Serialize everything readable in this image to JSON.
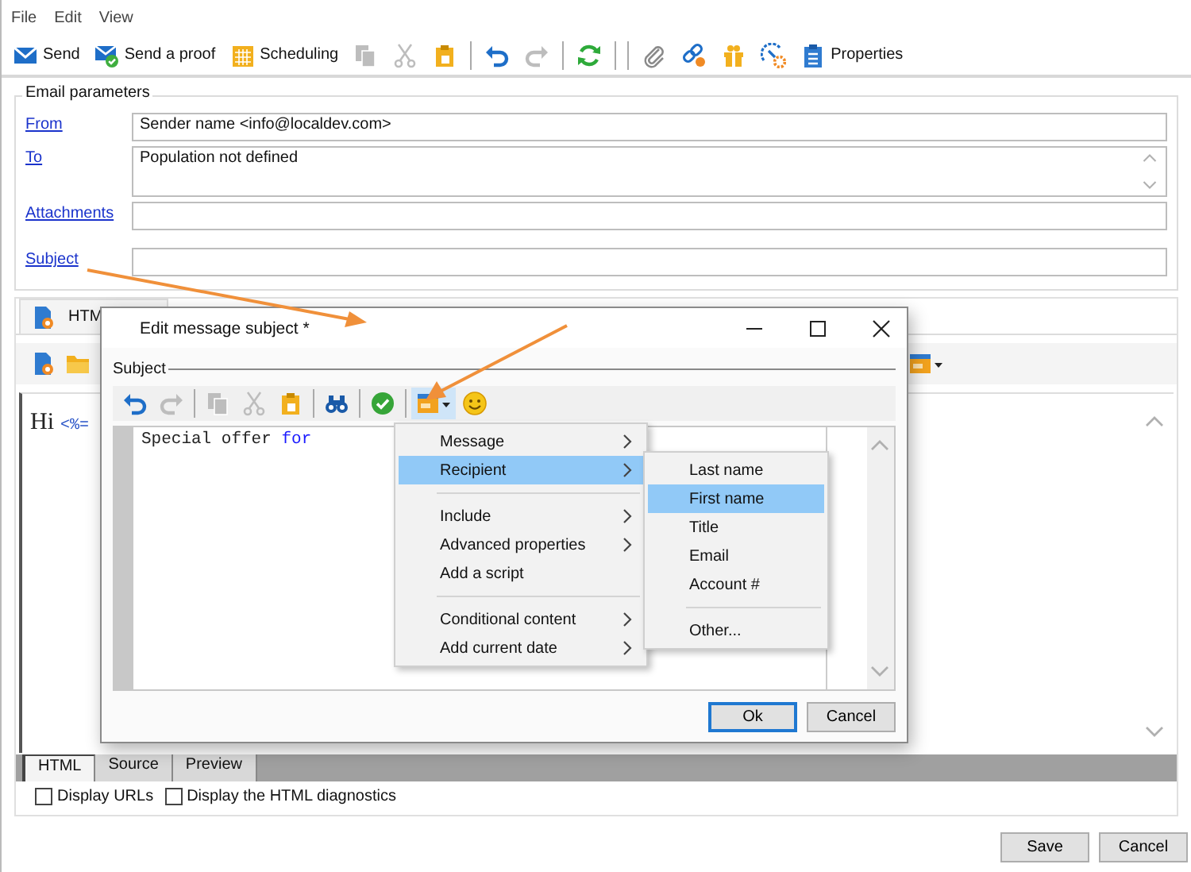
{
  "menu_bar": [
    {
      "label": "File"
    },
    {
      "label": "Edit"
    },
    {
      "label": "View"
    }
  ],
  "toolbar": [
    {
      "kind": "button",
      "label": "Send",
      "disabled": false
    },
    {
      "kind": "button",
      "label": "Send a proof",
      "disabled": false
    },
    {
      "kind": "button",
      "label": "Scheduling",
      "disabled": false
    },
    {
      "kind": "button",
      "disabled": true
    },
    {
      "kind": "button",
      "disabled": true
    },
    {
      "kind": "button",
      "disabled": false
    },
    {
      "kind": "separator"
    },
    {
      "kind": "button",
      "disabled": false
    },
    {
      "kind": "button",
      "disabled": true
    },
    {
      "kind": "separator"
    },
    {
      "kind": "button",
      "disabled": false
    },
    {
      "kind": "separator"
    },
    {
      "kind": "separator"
    },
    {
      "kind": "button",
      "disabled": false
    },
    {
      "kind": "button",
      "disabled": false
    },
    {
      "kind": "button",
      "disabled": false
    },
    {
      "kind": "button",
      "disabled": false
    },
    {
      "kind": "button",
      "label": "Properties",
      "disabled": false
    }
  ],
  "email_parameters": {
    "title": "Email parameters",
    "fields": [
      {
        "label": "From",
        "kind": "line",
        "value": "Sender name <info@localdev.com>"
      },
      {
        "label": "To",
        "kind": "multiline",
        "value": "Population not defined"
      },
      {
        "label": "Attachments",
        "kind": "line"
      },
      {
        "label": "Subject",
        "kind": "line"
      }
    ]
  },
  "content_tabs": [
    {
      "label": "HTM"
    }
  ],
  "editor_lines": [
    [
      {
        "kind": "plain",
        "text": "Hi"
      },
      {
        "kind": "code",
        "text": "<%="
      }
    ]
  ],
  "view_tabs": [
    {
      "label": "HTML",
      "selected": true
    },
    {
      "label": "Source",
      "selected": false
    },
    {
      "label": "Preview",
      "selected": false
    }
  ],
  "options": [
    {
      "label": "Display URLs",
      "checked": false
    },
    {
      "label": "Display the HTML diagnostics",
      "checked": false
    }
  ],
  "buttons": [
    {
      "label": "Save"
    },
    {
      "label": "Cancel"
    }
  ],
  "dialog": {
    "title": "Edit message subject *",
    "section": "Subject",
    "toolbar": [
      {
        "kind": "button",
        "disabled": false
      },
      {
        "kind": "button",
        "disabled": true
      },
      {
        "kind": "separator"
      },
      {
        "kind": "button",
        "disabled": true
      },
      {
        "kind": "button",
        "disabled": true
      },
      {
        "kind": "button",
        "disabled": false
      },
      {
        "kind": "separator"
      },
      {
        "kind": "button",
        "disabled": false
      },
      {
        "kind": "separator"
      },
      {
        "kind": "button",
        "disabled": false
      },
      {
        "kind": "separator"
      },
      {
        "kind": "button",
        "disabled": false,
        "active": true
      },
      {
        "kind": "button",
        "disabled": false
      }
    ],
    "lines": [
      [
        {
          "kind": "plain",
          "text": "Special offer "
        },
        {
          "kind": "keyword",
          "text": "for"
        }
      ]
    ],
    "buttons": [
      {
        "label": "Ok",
        "default": true
      },
      {
        "label": "Cancel",
        "default": false
      }
    ]
  },
  "menu": {
    "items": [
      {
        "kind": "item",
        "label": "Message",
        "submenu": true,
        "selected": false
      },
      {
        "kind": "item",
        "label": "Recipient",
        "submenu": true,
        "selected": true,
        "children": [
          {
            "kind": "item",
            "label": "Last name",
            "selected": false
          },
          {
            "kind": "item",
            "label": "First name",
            "selected": true
          },
          {
            "kind": "item",
            "label": "Title",
            "selected": false
          },
          {
            "kind": "item",
            "label": "Email",
            "selected": false
          },
          {
            "kind": "item",
            "label": "Account #",
            "selected": false
          },
          {
            "kind": "separator"
          },
          {
            "kind": "item",
            "label": "Other...",
            "selected": false
          }
        ]
      },
      {
        "kind": "separator"
      },
      {
        "kind": "item",
        "label": "Include",
        "submenu": true,
        "selected": false
      },
      {
        "kind": "item",
        "label": "Advanced properties",
        "submenu": true,
        "selected": false
      },
      {
        "kind": "item",
        "label": "Add a script",
        "submenu": false,
        "selected": false
      },
      {
        "kind": "separator"
      },
      {
        "kind": "item",
        "label": "Conditional content",
        "submenu": true,
        "selected": false
      },
      {
        "kind": "item",
        "label": "Add current date",
        "submenu": true,
        "selected": false
      }
    ]
  }
}
